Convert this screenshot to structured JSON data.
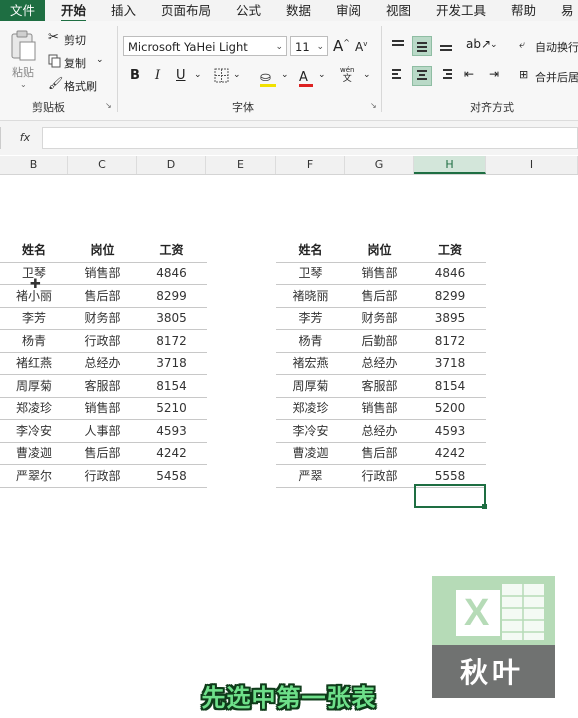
{
  "menu": {
    "tabs": [
      "文件",
      "开始",
      "插入",
      "页面布局",
      "公式",
      "数据",
      "审阅",
      "视图",
      "开发工具",
      "帮助",
      "易用"
    ]
  },
  "ribbon": {
    "clipboard": {
      "paste": "粘贴",
      "cut": "剪切",
      "copy": "复制",
      "format_painter": "格式刷",
      "group_label": "剪贴板"
    },
    "font": {
      "font_name": "Microsoft YaHei Light",
      "font_size": "11",
      "grow": "A",
      "shrink": "A",
      "bold": "B",
      "italic": "I",
      "underline": "U",
      "font_color_glyph": "A",
      "phonetic": "wén",
      "phonetic2": "文",
      "group_label": "字体"
    },
    "alignment": {
      "wrap_text": "自动换行",
      "merge_center": "合并后居",
      "group_label": "对齐方式"
    }
  },
  "formula_bar": {
    "fx": "fx",
    "value": ""
  },
  "columns": [
    "B",
    "C",
    "D",
    "E",
    "F",
    "G",
    "H",
    "I"
  ],
  "table1": {
    "headers": [
      "姓名",
      "岗位",
      "工资"
    ],
    "rows": [
      [
        "卫琴",
        "销售部",
        "4846"
      ],
      [
        "褚小丽",
        "售后部",
        "8299"
      ],
      [
        "李芳",
        "财务部",
        "3805"
      ],
      [
        "杨青",
        "行政部",
        "8172"
      ],
      [
        "褚红燕",
        "总经办",
        "3718"
      ],
      [
        "周厚菊",
        "客服部",
        "8154"
      ],
      [
        "郑凌珍",
        "销售部",
        "5210"
      ],
      [
        "李冷安",
        "人事部",
        "4593"
      ],
      [
        "曹凌迦",
        "售后部",
        "4242"
      ],
      [
        "严翠尔",
        "行政部",
        "5458"
      ]
    ]
  },
  "table2": {
    "headers": [
      "姓名",
      "岗位",
      "工资"
    ],
    "rows": [
      [
        "卫琴",
        "销售部",
        "4846"
      ],
      [
        "褚晓丽",
        "售后部",
        "8299"
      ],
      [
        "李芳",
        "财务部",
        "3895"
      ],
      [
        "杨青",
        "后勤部",
        "8172"
      ],
      [
        "褚宏燕",
        "总经办",
        "3718"
      ],
      [
        "周厚菊",
        "客服部",
        "8154"
      ],
      [
        "郑凌珍",
        "销售部",
        "5200"
      ],
      [
        "李冷安",
        "总经办",
        "4593"
      ],
      [
        "曹凌迦",
        "售后部",
        "4242"
      ],
      [
        "严翠",
        "行政部",
        "5558"
      ]
    ]
  },
  "logo": {
    "text": "秋叶",
    "letter": "X"
  },
  "subtitle": "先选中第一张表",
  "colors": {
    "accent": "#1e6e42",
    "logo_green": "#b6dbb7",
    "logo_gray": "#707271",
    "subtitle": "#6ee08a"
  }
}
